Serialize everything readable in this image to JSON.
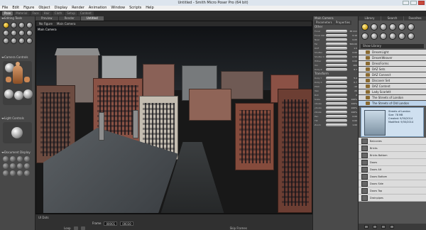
{
  "window": {
    "title": "Untitled - Smith Micro Poser Pro (64 bit)"
  },
  "menu": [
    "File",
    "Edit",
    "Figure",
    "Object",
    "Display",
    "Render",
    "Animation",
    "Window",
    "Scripts",
    "Help"
  ],
  "rooms": [
    "Pose",
    "Material",
    "Face",
    "Hair",
    "Cloth",
    "Setup",
    "Content"
  ],
  "doc_tabs": [
    "Preview",
    "Render",
    "Untitled"
  ],
  "left": {
    "editing_tools": "Editing Tools",
    "camera_controls": "Camera Controls",
    "light_controls": "Light Controls",
    "document_display": "Document Display"
  },
  "viewport": {
    "figure_menu": "No Figure",
    "camera_menu": "Main Camera",
    "camera_label": "Main Camera"
  },
  "timeline": {
    "ui_dots": "UI Dots",
    "frame_label": "Frame",
    "frame_current": "00001",
    "frame_total": "00030",
    "loop": "Loop",
    "skip_frames": "Skip Frames"
  },
  "params": {
    "title": "Main Camera",
    "tabs": [
      "Parameters",
      "Properties"
    ],
    "groups": [
      "Other",
      "Transform"
    ],
    "dials": [
      {
        "label": "Focal",
        "value": "38 mm"
      },
      {
        "label": "Focal dist",
        "value": "0.10"
      },
      {
        "label": "Near",
        "value": "0.05"
      },
      {
        "label": "Far",
        "value": "500.00"
      },
      {
        "label": "DOF",
        "value": "1.5"
      },
      {
        "label": "Shutter",
        "value": "0.00"
      },
      {
        "label": "Shutter Close",
        "value": "0.50"
      },
      {
        "label": "Hither",
        "value": "0.00"
      },
      {
        "label": "Yon",
        "value": "100"
      },
      {
        "label": "Dolly Z",
        "value": "8.7"
      },
      {
        "label": "Dolly Y",
        "value": "5.4"
      },
      {
        "label": "Dolly X",
        "value": "0.7"
      },
      {
        "label": "Pitch",
        "value": "-10"
      },
      {
        "label": "Yaw",
        "value": "26"
      },
      {
        "label": "Roll",
        "value": "0"
      },
      {
        "label": "Scale",
        "value": "100%"
      },
      {
        "label": "xScale",
        "value": "100%"
      },
      {
        "label": "yScale",
        "value": "100%"
      },
      {
        "label": "zScale",
        "value": "100%"
      },
      {
        "label": "Pan",
        "value": "0.00"
      },
      {
        "label": "Tilt",
        "value": "0.00"
      },
      {
        "label": "Zoom",
        "value": "1.00"
      }
    ]
  },
  "library": {
    "tabs": [
      "Library",
      "Search",
      "Favorites"
    ],
    "path": "Show Library",
    "folders": [
      "DreamLight",
      "DreamWeaver",
      "DressForms",
      "DAZ Sets",
      "DAZ Connect",
      "Discover Set",
      "DAZ Content",
      "Lady Scarlett",
      "The Streets of London",
      "The Streets of Old London"
    ],
    "preview": {
      "title": "Streets of London",
      "size": "Size: 78 MB",
      "created": "Created: 9/30/2014",
      "modified": "Modified: 9/30/2014"
    },
    "items": [
      "Balconies",
      "Bricks",
      "Bricks Bottom",
      "Doors",
      "Doors Alt",
      "Doors Bottom",
      "Doors Side",
      "Doors Top",
      "Drainpipes"
    ]
  }
}
